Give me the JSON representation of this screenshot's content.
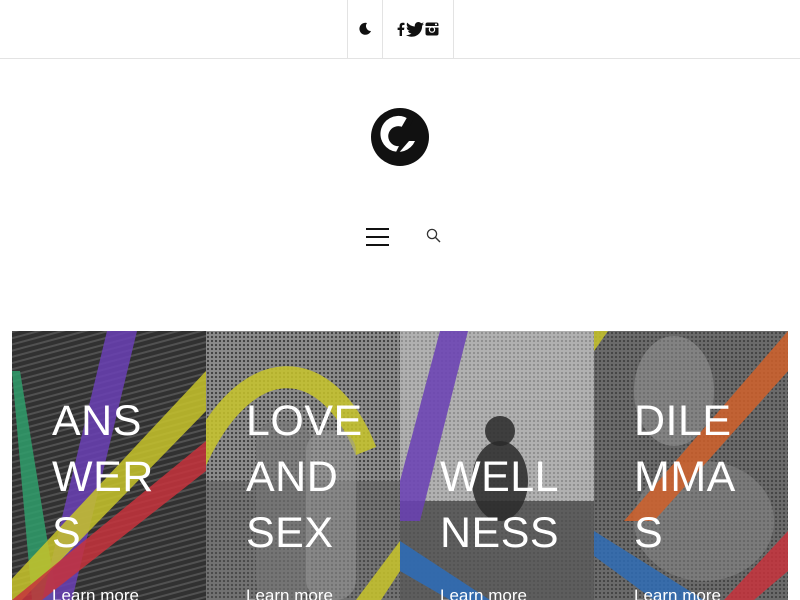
{
  "header": {
    "dark_mode_icon": "moon-icon",
    "social": [
      {
        "name": "facebook",
        "icon": "facebook-icon"
      },
      {
        "name": "twitter",
        "icon": "twitter-icon"
      },
      {
        "name": "instagram",
        "icon": "instagram-icon"
      }
    ]
  },
  "logo": {
    "icon": "site-logo"
  },
  "nav": {
    "menu_icon": "hamburger-icon",
    "search_icon": "search-icon"
  },
  "cards": [
    {
      "title": "ANS\nWER\nS",
      "link": "Learn more"
    },
    {
      "title": "LOVE\nAND\nSEX",
      "link": "Learn more"
    },
    {
      "title": "WELL\nNESS",
      "link": "Learn more"
    },
    {
      "title": "DILE\nMMA\nS",
      "link": "Learn more"
    }
  ],
  "colors": {
    "purple": "#6a3fb5",
    "yellow": "#c8c42a",
    "red": "#c7323c",
    "green": "#2f9e6b",
    "blue": "#2f6cb5",
    "orange": "#d0602a"
  }
}
